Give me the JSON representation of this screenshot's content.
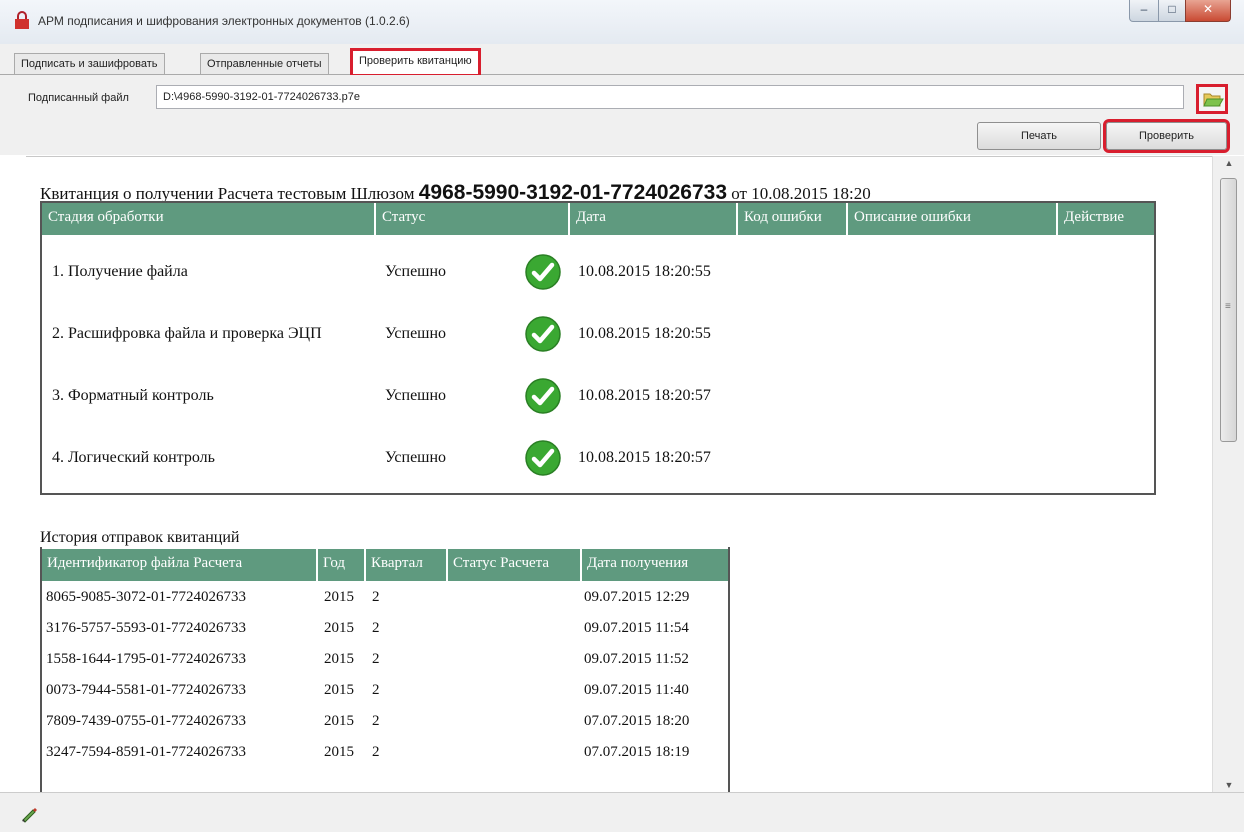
{
  "window": {
    "title": "АРМ подписания и шифрования электронных документов (1.0.2.6)",
    "controls": {
      "minimize": "–",
      "maximize": "□",
      "close": "✕"
    }
  },
  "tabs": [
    {
      "label": "Подписать и зашифровать"
    },
    {
      "label": "Отправленные отчеты"
    },
    {
      "label": "Проверить квитанцию",
      "active": true
    }
  ],
  "form": {
    "file_label": "Подписанный файл",
    "file_value": "D:\\4968-5990-3192-01-7724026733.p7e",
    "browse_icon": "folder-open-icon",
    "print_label": "Печать",
    "check_label": "Проверить"
  },
  "receipt": {
    "title_prefix": "Квитанция о получении Расчета тестовым Шлюзом",
    "file_id": "4968-5990-3192-01-7724026733",
    "title_suffix": "от 10.08.2015 18:20",
    "headers": [
      "Стадия обработки",
      "Статус",
      "Дата",
      "Код ошибки",
      "Описание ошибки",
      "Действие"
    ],
    "rows": [
      {
        "stage": "1. Получение файла",
        "status": "Успешно",
        "date": "10.08.2015 18:20:55",
        "icon": "check-circle-icon"
      },
      {
        "stage": "2. Расшифровка файла и проверка ЭЦП",
        "status": "Успешно",
        "date": "10.08.2015 18:20:55",
        "icon": "check-circle-icon"
      },
      {
        "stage": "3. Форматный контроль",
        "status": "Успешно",
        "date": "10.08.2015 18:20:57",
        "icon": "check-circle-icon"
      },
      {
        "stage": "4. Логический контроль",
        "status": "Успешно",
        "date": "10.08.2015 18:20:57",
        "icon": "check-circle-icon"
      }
    ]
  },
  "history": {
    "title": "История отправок квитанций",
    "headers": [
      "Идентификатор файла Расчета",
      "Год",
      "Квартал",
      "Статус Расчета",
      "Дата получения"
    ],
    "rows": [
      {
        "id": "8065-9085-3072-01-7724026733",
        "year": "2015",
        "quarter": "2",
        "status": "",
        "date": "09.07.2015 12:29"
      },
      {
        "id": "3176-5757-5593-01-7724026733",
        "year": "2015",
        "quarter": "2",
        "status": "",
        "date": "09.07.2015 11:54"
      },
      {
        "id": "1558-1644-1795-01-7724026733",
        "year": "2015",
        "quarter": "2",
        "status": "",
        "date": "09.07.2015 11:52"
      },
      {
        "id": "0073-7944-5581-01-7724026733",
        "year": "2015",
        "quarter": "2",
        "status": "",
        "date": "09.07.2015 11:40"
      },
      {
        "id": "7809-7439-0755-01-7724026733",
        "year": "2015",
        "quarter": "2",
        "status": "",
        "date": "07.07.2015 18:20"
      },
      {
        "id": "3247-7594-8591-01-7724026733",
        "year": "2015",
        "quarter": "2",
        "status": "",
        "date": "07.07.2015 18:19"
      }
    ]
  },
  "colors": {
    "header_green": "#5f9a7f",
    "highlight_red": "#d81e2e",
    "check_green": "#3aa832"
  }
}
